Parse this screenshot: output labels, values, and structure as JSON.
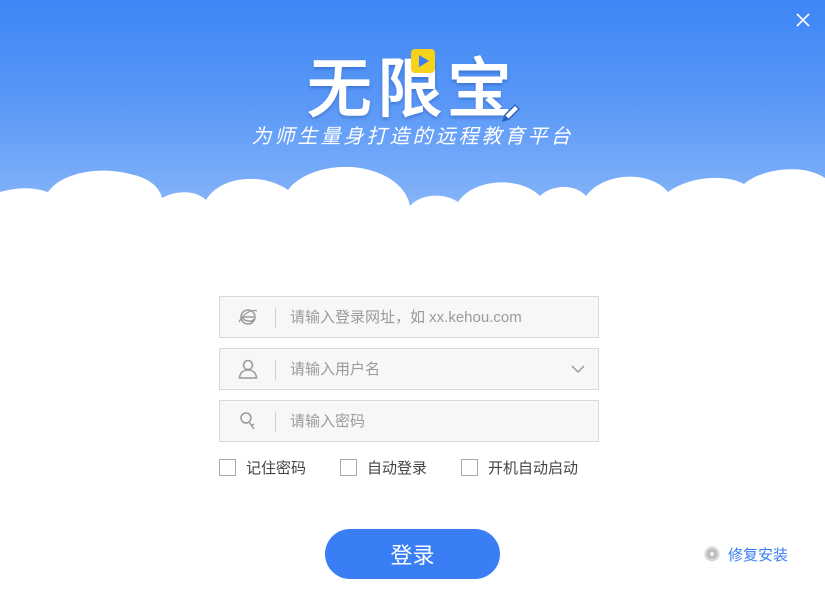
{
  "app": {
    "logo_text": "无限宝",
    "slogan": "为师生量身打造的远程教育平台"
  },
  "login": {
    "url_placeholder": "请输入登录网址，如 xx.kehou.com",
    "username_placeholder": "请输入用户名",
    "password_placeholder": "请输入密码",
    "remember_password": "记住密码",
    "auto_login": "自动登录",
    "launch_on_startup": "开机自动启动",
    "login_button": "登录",
    "repair_install": "修复安装"
  },
  "colors": {
    "accent": "#3a7ef5",
    "banner_top": "#3d86f5",
    "banner_bottom": "#8fbaf9",
    "play_badge": "#f7d21a"
  },
  "icons": {
    "close": "close-icon",
    "browser": "browser-icon",
    "user": "user-icon",
    "key": "key-icon",
    "dropdown": "chevron-down-icon",
    "repair": "gear-icon"
  }
}
